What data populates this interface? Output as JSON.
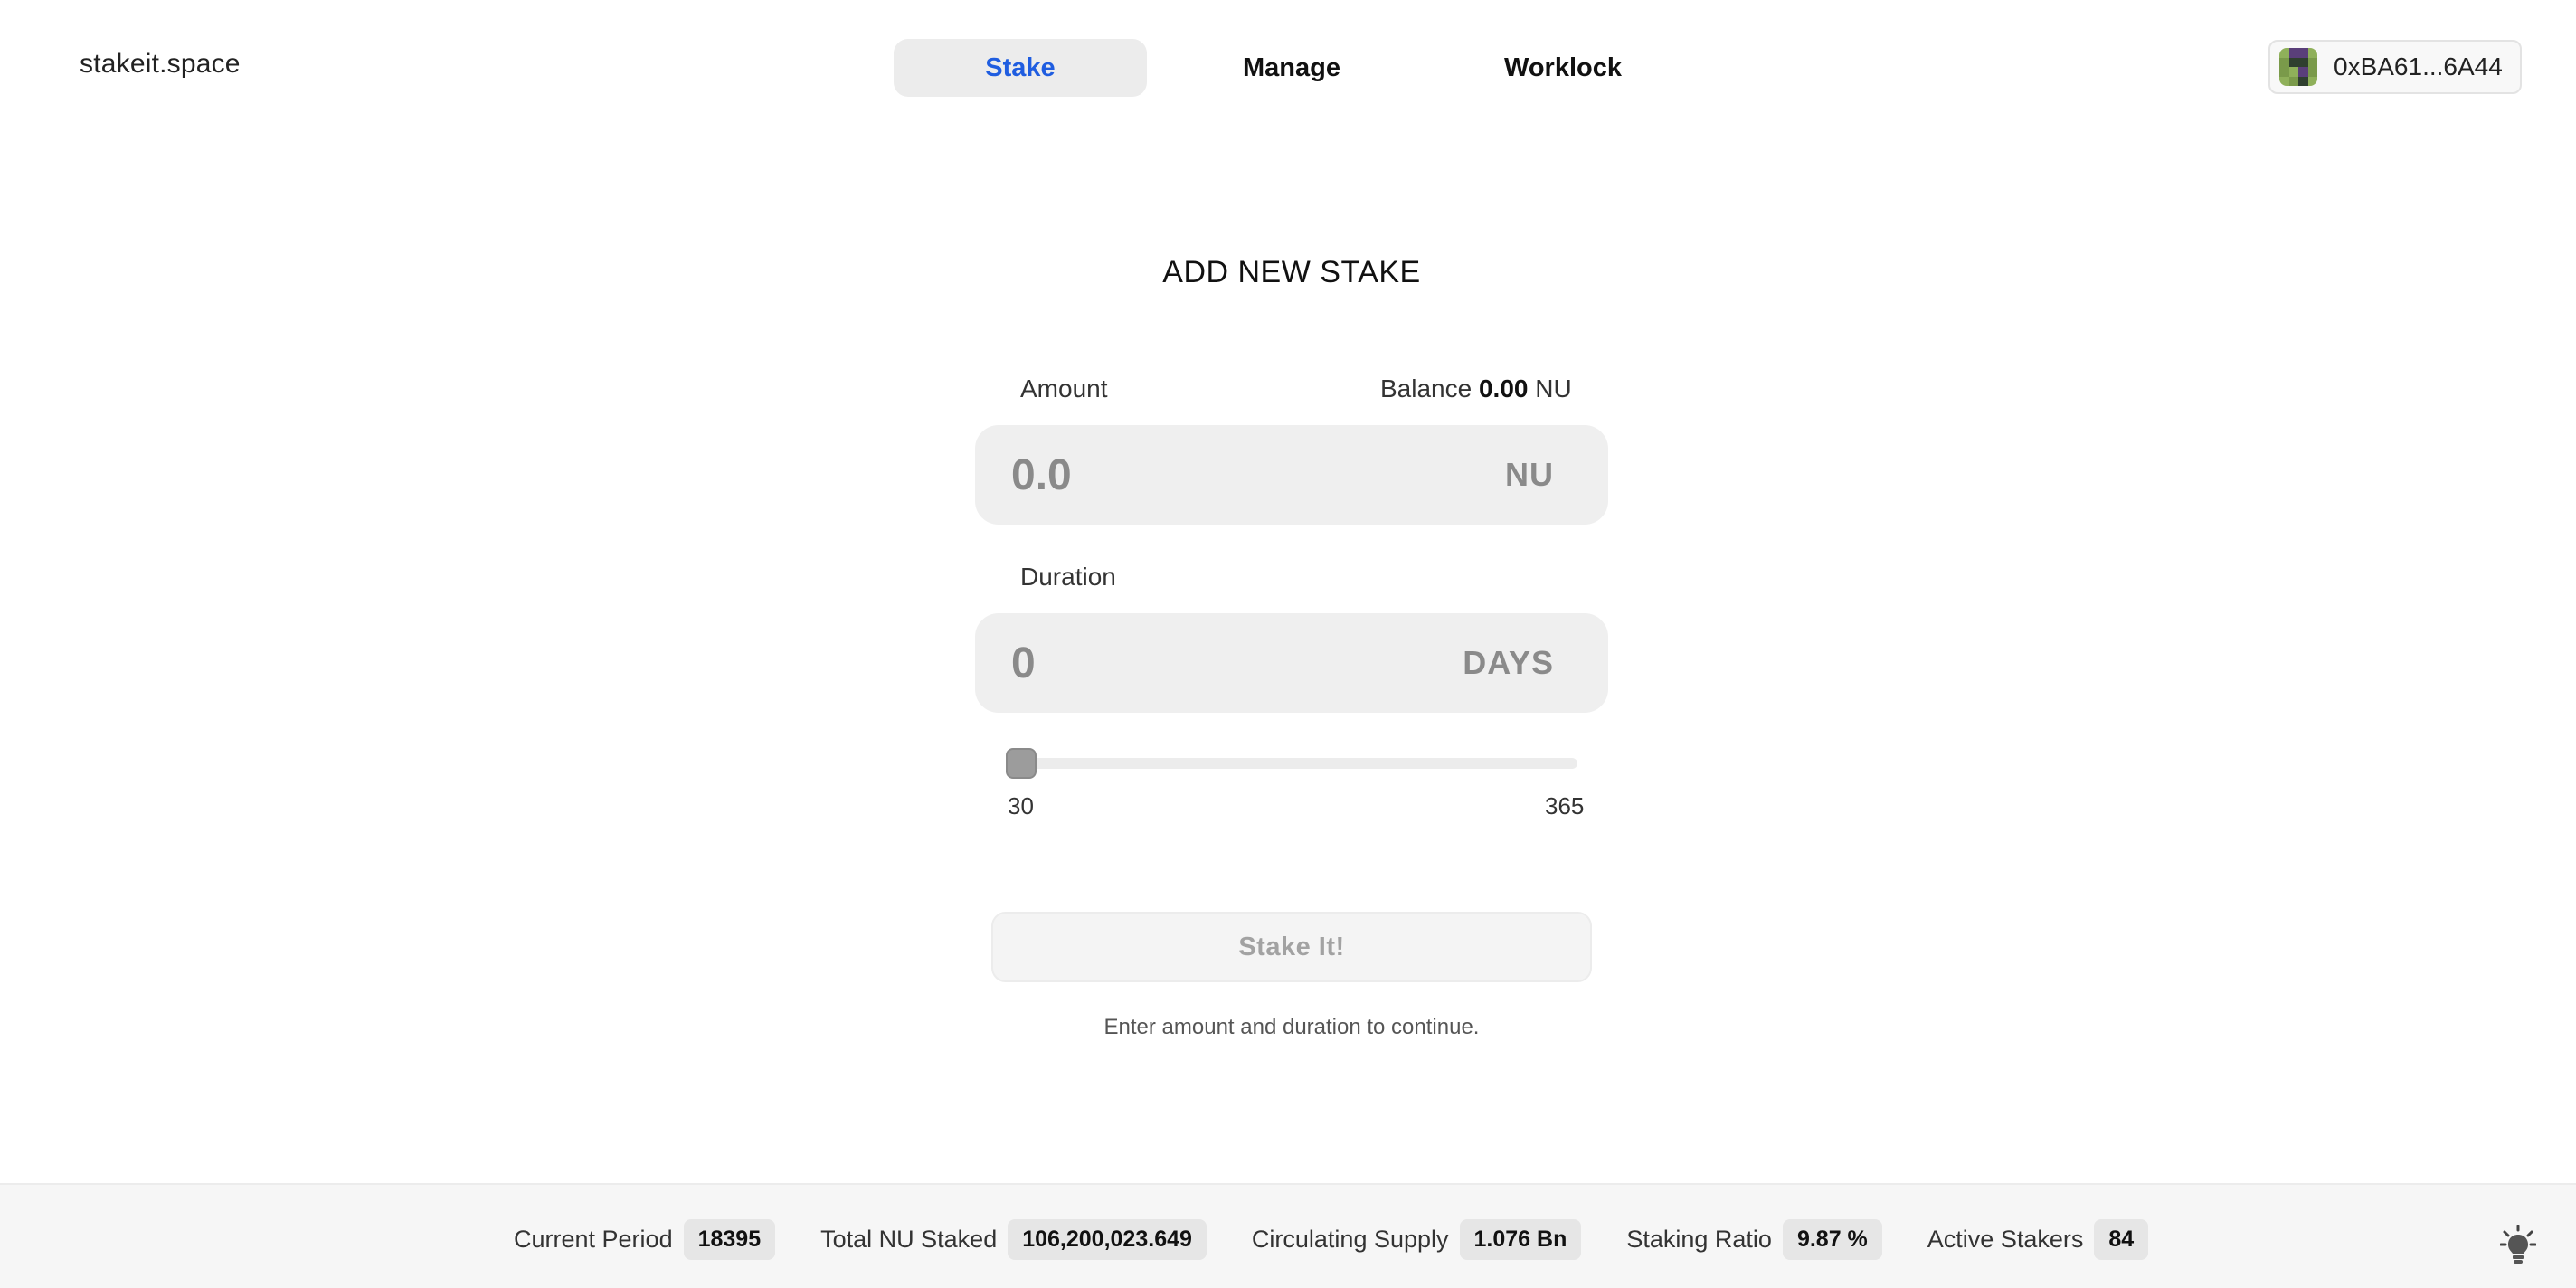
{
  "header": {
    "logo": "stakeit.space",
    "tabs": [
      {
        "label": "Stake",
        "active": true
      },
      {
        "label": "Manage",
        "active": false
      },
      {
        "label": "Worklock",
        "active": false
      }
    ],
    "wallet": {
      "address": "0xBA61...6A44",
      "avatar_icon": "identicon-avatar"
    }
  },
  "form": {
    "title": "ADD NEW STAKE",
    "amount": {
      "label": "Amount",
      "placeholder": "0.0",
      "value": "",
      "unit": "NU",
      "balance_label": "Balance",
      "balance_value": "0.00",
      "balance_unit": "NU"
    },
    "duration": {
      "label": "Duration",
      "placeholder": "0",
      "value": "",
      "unit": "DAYS"
    },
    "slider": {
      "min": "30",
      "max": "365",
      "current": 30
    },
    "submit_label": "Stake It!",
    "hint": "Enter amount and duration to continue."
  },
  "footer": {
    "stats": [
      {
        "label": "Current Period",
        "value": "18395"
      },
      {
        "label": "Total NU Staked",
        "value": "106,200,023.649"
      },
      {
        "label": "Circulating Supply",
        "value": "1.076 Bn"
      },
      {
        "label": "Staking Ratio",
        "value": "9.87 %"
      },
      {
        "label": "Active Stakers",
        "value": "84"
      }
    ],
    "theme_toggle_icon": "lightbulb-icon"
  },
  "colors": {
    "accent": "#1f5de0",
    "avatar": [
      "#7a9a4a",
      "#5a3f7a",
      "#2f3f2f",
      "#8fb05a"
    ]
  }
}
